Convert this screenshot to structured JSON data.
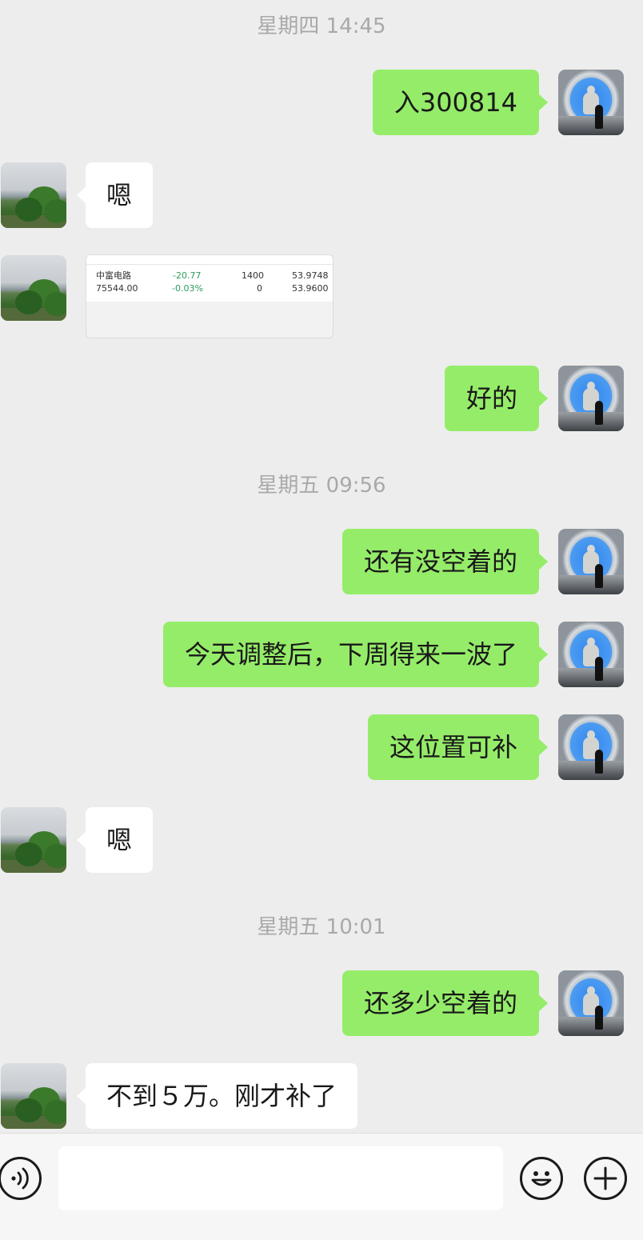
{
  "timestamps": [
    "星期四 14:45",
    "星期五 09:56",
    "星期五 10:01"
  ],
  "messages": [
    {
      "text": "入300814"
    },
    {
      "text": "嗯"
    },
    {
      "text": "好的"
    },
    {
      "text": "还有没空着的"
    },
    {
      "text": "今天调整后，下周得来一波了"
    },
    {
      "text": "这位置可补"
    },
    {
      "text": "嗯"
    },
    {
      "text": "还多少空着的"
    },
    {
      "text": "不到５万。刚才补了"
    }
  ],
  "image_message": {
    "rows": [
      {
        "name": "中富电路",
        "change": "-20.77",
        "qty": "1400",
        "price": "53.9748"
      },
      {
        "name": "75544.00",
        "change": "-0.03%",
        "qty": "0",
        "price": "53.9600"
      }
    ]
  },
  "input_bar": {
    "icons": [
      "voice-icon",
      "emoji-icon",
      "plus-icon"
    ]
  },
  "colors": {
    "background": "#ededed",
    "self_bubble": "#95ec69",
    "other_bubble": "#ffffff",
    "timestamp": "#a9a9a9"
  }
}
